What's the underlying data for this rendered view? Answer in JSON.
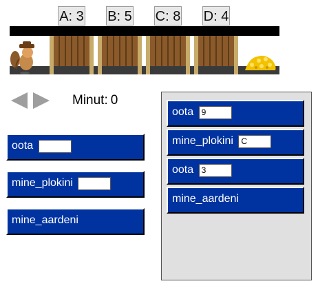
{
  "scene": {
    "gates": [
      {
        "label": "A: 3"
      },
      {
        "label": "B: 5"
      },
      {
        "label": "C: 8"
      },
      {
        "label": "D: 4"
      }
    ],
    "character": "miner",
    "treasure": "gold-pile"
  },
  "controls": {
    "timer_label": "Minut:",
    "timer_value": "0"
  },
  "palette": [
    {
      "label": "oota",
      "value": ""
    },
    {
      "label": "mine_plokini",
      "value": ""
    },
    {
      "label": "mine_aardeni"
    }
  ],
  "program": [
    {
      "label": "oota",
      "value": "9"
    },
    {
      "label": "mine_plokini",
      "value": "C"
    },
    {
      "label": "oota",
      "value": "3"
    },
    {
      "label": "mine_aardeni"
    }
  ],
  "colors": {
    "block": "#0033a0",
    "workspace": "#e0e0e0"
  }
}
